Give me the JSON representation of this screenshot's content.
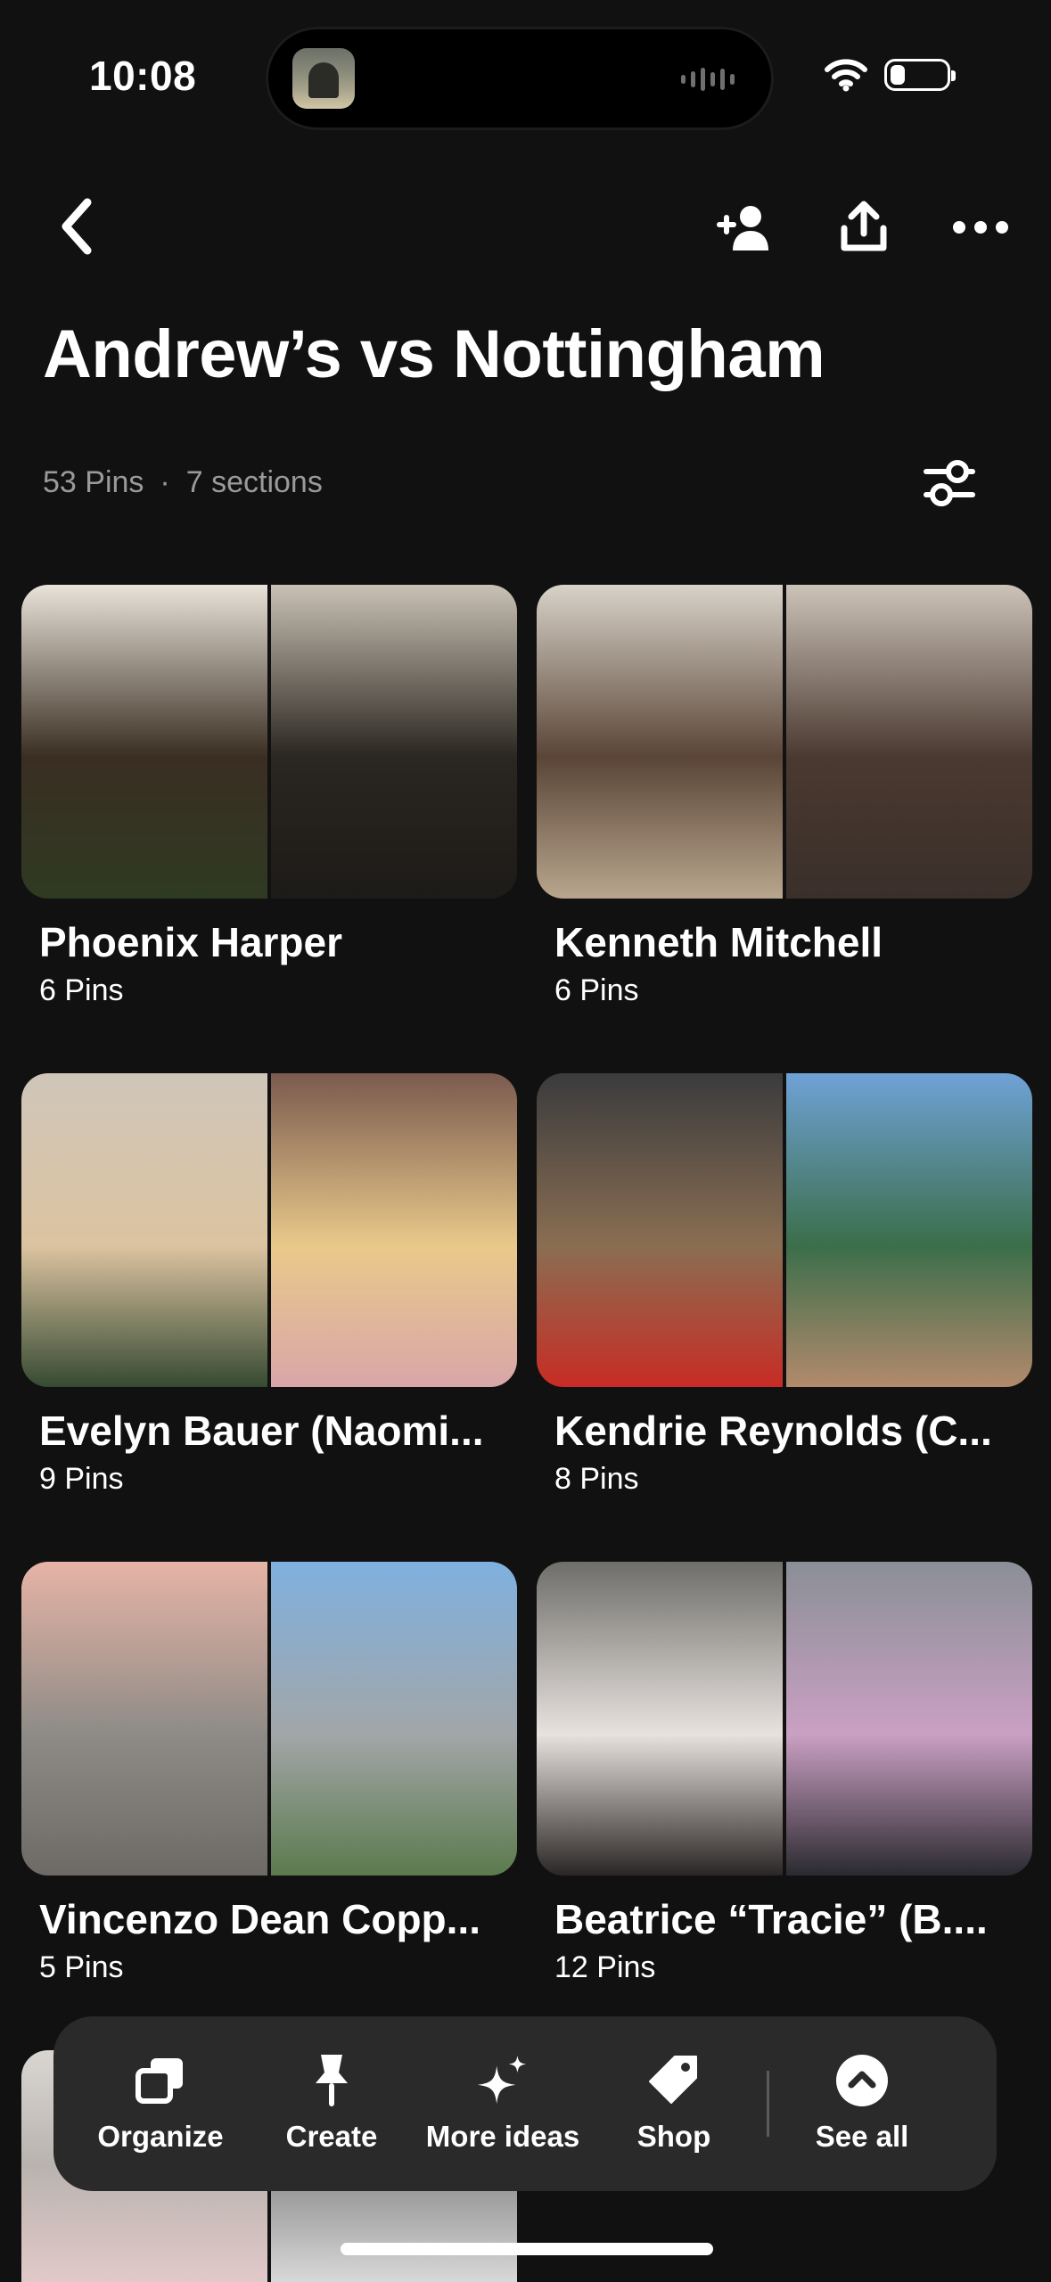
{
  "status_bar": {
    "time": "10:08"
  },
  "board": {
    "title": "Andrew’s vs Nottingham",
    "pins_count": "53 Pins",
    "separator": "·",
    "sections_count": "7 sections"
  },
  "header_icons": [
    "back-icon",
    "add-collaborator-icon",
    "share-icon",
    "more-icon",
    "filter-icon"
  ],
  "sections": [
    {
      "name": "Phoenix Harper",
      "count": "6 Pins",
      "colors": [
        [
          "#e9e3d9",
          "#3a2e22",
          "#2f3a22"
        ],
        [
          "#c9c1b4",
          "#2a2620",
          "#1d1b18"
        ]
      ]
    },
    {
      "name": "Kenneth Mitchell",
      "count": "6 Pins",
      "colors": [
        [
          "#d8d2c8",
          "#5a4537",
          "#b9a68d"
        ],
        [
          "#ccc3b8",
          "#4a3930",
          "#3a2f2a"
        ]
      ]
    },
    {
      "name": "Evelyn Bauer (Naomi...",
      "count": "9 Pins",
      "colors": [
        [
          "#cfc6b9",
          "#dcc3a0",
          "#364a32"
        ],
        [
          "#7a5a4e",
          "#e9c98a",
          "#d8a6a8"
        ]
      ]
    },
    {
      "name": "Kendrie Reynolds (C...",
      "count": "8 Pins",
      "colors": [
        [
          "#3a3b3d",
          "#8a6e52",
          "#c82c24"
        ],
        [
          "#6fa2d6",
          "#3b6e4a",
          "#b38a6c"
        ]
      ]
    },
    {
      "name": "Vincenzo Dean Copp...",
      "count": "5 Pins",
      "colors": [
        [
          "#e6b4a6",
          "#8e8b86",
          "#6d6a66"
        ],
        [
          "#7fb0df",
          "#a2a6a8",
          "#5b7a4d"
        ]
      ]
    },
    {
      "name": "Beatrice “Tracie” (B....",
      "count": "12 Pins",
      "colors": [
        [
          "#6f6e6a",
          "#e8e2df",
          "#2a2625"
        ],
        [
          "#8a8f96",
          "#caa0c3",
          "#2b2a30"
        ]
      ]
    }
  ],
  "toolbar": {
    "organize": "Organize",
    "create": "Create",
    "more_ideas": "More ideas",
    "shop": "Shop",
    "see_all": "See all"
  }
}
